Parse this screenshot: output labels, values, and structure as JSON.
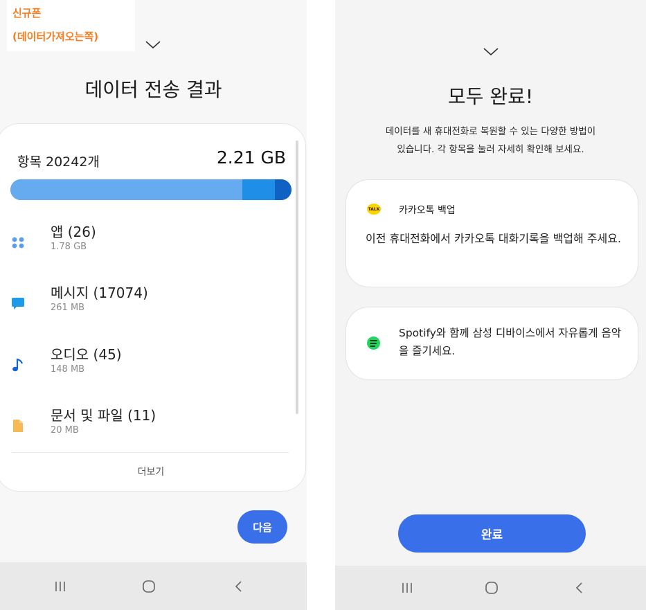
{
  "annotation": {
    "line1": "신규폰",
    "line2": "(데이터가져오는쪽)",
    "color": "#f57c20"
  },
  "left_screen": {
    "title": "데이터 전송 결과",
    "count_label": "항목 20242개",
    "total_size": "2.21 GB",
    "items": [
      {
        "name": "앱 (26)",
        "size": "1.78 GB",
        "icon": "apps-grid-icon",
        "color": "#5d9df0"
      },
      {
        "name": "메시지 (17074)",
        "size": "261 MB",
        "icon": "message-bubble-icon",
        "color": "#1e9be8"
      },
      {
        "name": "오디오 (45)",
        "size": "148 MB",
        "icon": "music-note-icon",
        "color": "#1566d1"
      },
      {
        "name": "문서 및 파일 (11)",
        "size": "20 MB",
        "icon": "document-file-icon",
        "color": "#f6b955"
      }
    ],
    "more_label": "더보기",
    "next_button": "다음",
    "accent": "#3a6fea"
  },
  "right_screen": {
    "title": "모두 완료!",
    "description_line1": "데이터를 새 휴대전화로 복원할 수 있는 다양한 방법이",
    "description_line2": "있습니다. 각 항목을 눌러 자세히 확인해 보세요.",
    "kakao": {
      "logo_text": "TALK",
      "title": "카카오톡 백업",
      "body": "이전 휴대전화에서 카카오톡 대화기록을 백업해 주세요."
    },
    "spotify": {
      "body": "Spotify와 함께 삼성 디바이스에서 자유롭게 음악을 즐기세요."
    },
    "done_button": "완료",
    "accent": "#3a6fea"
  },
  "nav": {
    "recent": "recent-apps-icon",
    "home": "home-icon",
    "back": "back-icon"
  }
}
